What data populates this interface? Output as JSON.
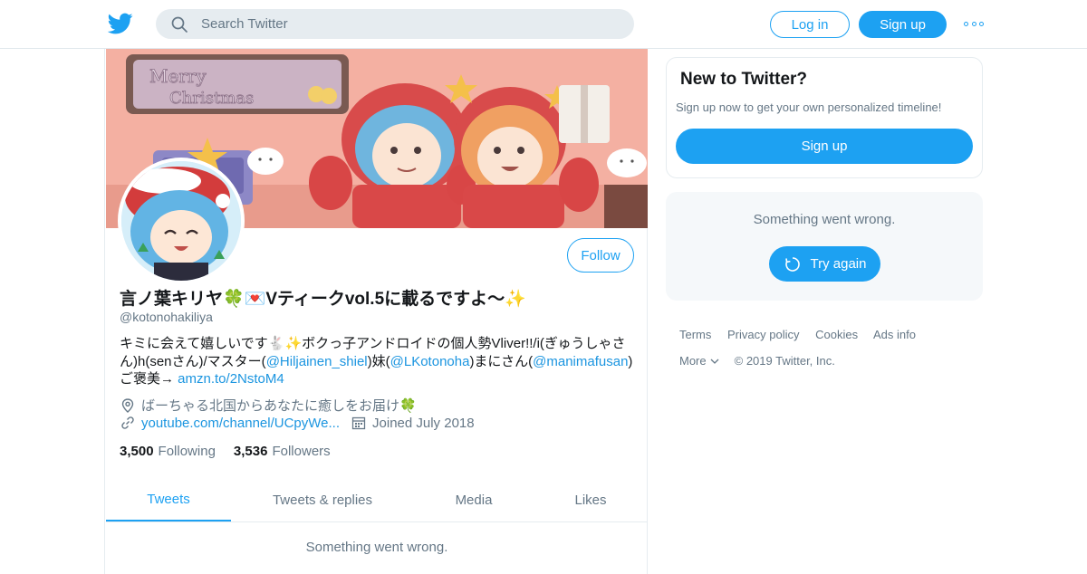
{
  "topbar": {
    "search_placeholder": "Search Twitter",
    "login_label": "Log in",
    "signup_label": "Sign up"
  },
  "profile": {
    "name": "言ノ葉キリヤ🍀💌Vティークvol.5に載るですよ～✨",
    "handle": "@kotonohakiliya",
    "follow_label": "Follow",
    "bio": {
      "line1": "キミに会えて嬉しいです🐇✨ボクっ子アンドロイドの個人勢Vliver!!/i(ぎゅうしゃさ",
      "line2_a": "ん)h(senさん)/マスター(",
      "mention1": "@Hiljainen_shiel",
      "line2_b": ")妹(",
      "mention2": "@LKotonoha",
      "line2_c": ")まにさん(",
      "mention3": "@manimafusan",
      "line2_d": ")",
      "line3_a": "ご褒美→ ",
      "link": "amzn.to/2NstoM4"
    },
    "location": "ばーちゃる北国からあなたに癒しをお届け🍀",
    "website": "youtube.com/channel/UCpyWe...",
    "joined": "Joined July 2018",
    "following_count": "3,500",
    "following_label": "Following",
    "followers_count": "3,536",
    "followers_label": "Followers"
  },
  "tabs": [
    "Tweets",
    "Tweets & replies",
    "Media",
    "Likes"
  ],
  "timeline_error": "Something went wrong.",
  "sidebar": {
    "new_title": "New to Twitter?",
    "new_sub": "Sign up now to get your own personalized timeline!",
    "new_signup": "Sign up",
    "error_text": "Something went wrong.",
    "retry_label": "Try again"
  },
  "footer": {
    "links": [
      "Terms",
      "Privacy policy",
      "Cookies",
      "Ads info"
    ],
    "more": "More",
    "copyright": "© 2019 Twitter, Inc."
  },
  "banner_text": {
    "line1": "Merry",
    "line2": "Christmas"
  },
  "colors": {
    "accent": "#1da1f2",
    "link": "#1b95e0",
    "muted": "#657786"
  }
}
